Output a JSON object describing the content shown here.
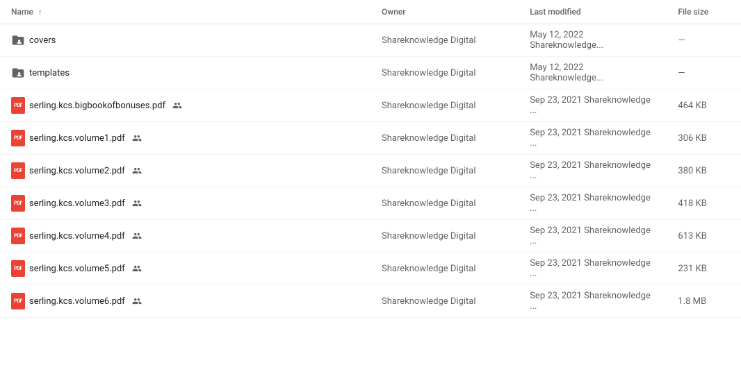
{
  "table": {
    "columns": {
      "name": "Name",
      "owner": "Owner",
      "modified": "Last modified",
      "size": "File size"
    },
    "rows": [
      {
        "id": "covers",
        "type": "folder",
        "name": "covers",
        "owner": "Shareknowledge Digital",
        "modified": "May 12, 2022",
        "modifier": "Shareknowledge...",
        "size": "—",
        "shared": false
      },
      {
        "id": "templates",
        "type": "folder",
        "name": "templates",
        "owner": "Shareknowledge Digital",
        "modified": "May 12, 2022",
        "modifier": "Shareknowledge...",
        "size": "—",
        "shared": false
      },
      {
        "id": "file1",
        "type": "pdf",
        "name": "serling.kcs.bigbookofbonuses.pdf",
        "owner": "Shareknowledge Digital",
        "modified": "Sep 23, 2021",
        "modifier": "Shareknowledge ...",
        "size": "464 KB",
        "shared": true
      },
      {
        "id": "file2",
        "type": "pdf",
        "name": "serling.kcs.volume1.pdf",
        "owner": "Shareknowledge Digital",
        "modified": "Sep 23, 2021",
        "modifier": "Shareknowledge ...",
        "size": "306 KB",
        "shared": true
      },
      {
        "id": "file3",
        "type": "pdf",
        "name": "serling.kcs.volume2.pdf",
        "owner": "Shareknowledge Digital",
        "modified": "Sep 23, 2021",
        "modifier": "Shareknowledge ...",
        "size": "380 KB",
        "shared": true
      },
      {
        "id": "file4",
        "type": "pdf",
        "name": "serling.kcs.volume3.pdf",
        "owner": "Shareknowledge Digital",
        "modified": "Sep 23, 2021",
        "modifier": "Shareknowledge ...",
        "size": "418 KB",
        "shared": true
      },
      {
        "id": "file5",
        "type": "pdf",
        "name": "serling.kcs.volume4.pdf",
        "owner": "Shareknowledge Digital",
        "modified": "Sep 23, 2021",
        "modifier": "Shareknowledge ...",
        "size": "613 KB",
        "shared": true
      },
      {
        "id": "file6",
        "type": "pdf",
        "name": "serling.kcs.volume5.pdf",
        "owner": "Shareknowledge Digital",
        "modified": "Sep 23, 2021",
        "modifier": "Shareknowledge ...",
        "size": "231 KB",
        "shared": true
      },
      {
        "id": "file7",
        "type": "pdf",
        "name": "serling.kcs.volume6.pdf",
        "owner": "Shareknowledge Digital",
        "modified": "Sep 23, 2021",
        "modifier": "Shareknowledge ...",
        "size": "1.8 MB",
        "shared": true
      }
    ]
  }
}
